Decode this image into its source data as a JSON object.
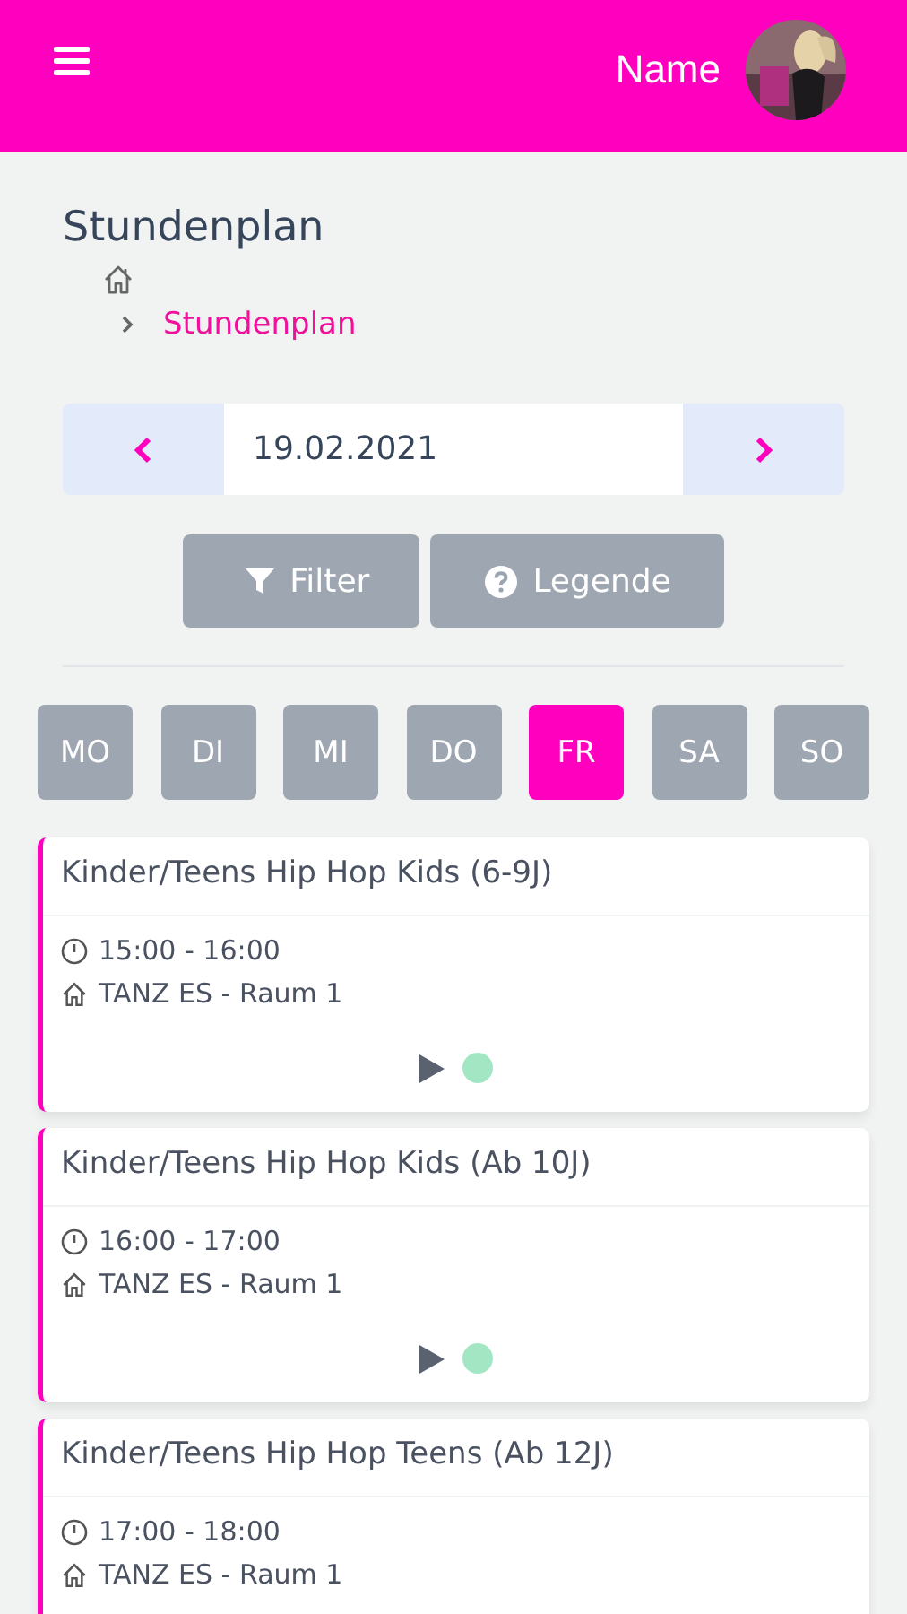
{
  "header": {
    "user_name": "Name"
  },
  "page_title": "Stundenplan",
  "breadcrumb": {
    "current": "Stundenplan"
  },
  "date_nav": {
    "value": "19.02.2021"
  },
  "buttons": [
    {
      "kind": "filter",
      "label": "Filter"
    },
    {
      "kind": "help",
      "label": "Legende"
    }
  ],
  "days": [
    {
      "label": "MO",
      "selected": false
    },
    {
      "label": "DI",
      "selected": false
    },
    {
      "label": "MI",
      "selected": false
    },
    {
      "label": "DO",
      "selected": false
    },
    {
      "label": "FR",
      "selected": true
    },
    {
      "label": "SA",
      "selected": false
    },
    {
      "label": "SO",
      "selected": false
    }
  ],
  "classes": [
    {
      "title": "Kinder/Teens Hip Hop Kids (6-9J)",
      "time": "15:00 - 16:00",
      "location": "TANZ ES - Raum 1",
      "color": "#a3e6c4"
    },
    {
      "title": "Kinder/Teens Hip Hop Kids (Ab 10J)",
      "time": "16:00 - 17:00",
      "location": "TANZ ES - Raum 1",
      "color": "#a3e6c4"
    },
    {
      "title": "Kinder/Teens Hip Hop Teens (Ab 12J)",
      "time": "17:00 - 18:00",
      "location": "TANZ ES - Raum 1"
    }
  ]
}
